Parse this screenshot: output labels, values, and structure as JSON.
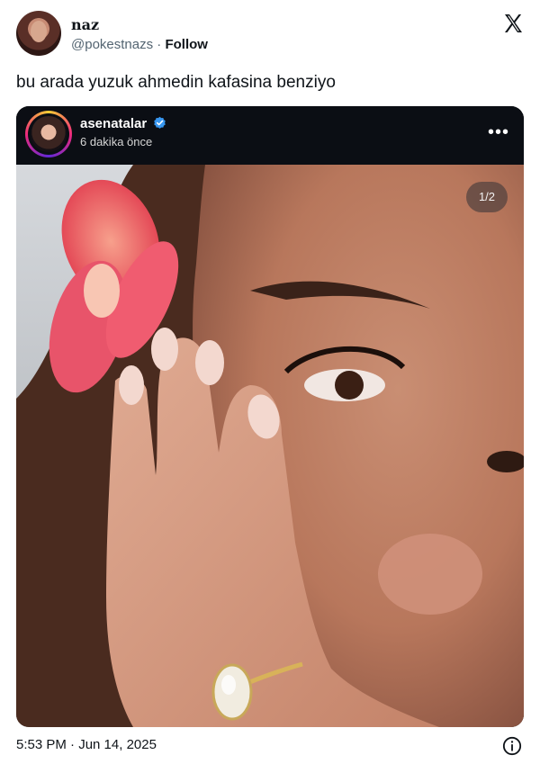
{
  "author": {
    "display_name": "naz",
    "handle": "@pokestnazs",
    "separator": "·",
    "follow_label": "Follow",
    "avatar_icon": "profile-photo",
    "platform_icon": "x-logo-icon"
  },
  "tweet": {
    "text": "bu arada yuzuk ahmedin kafasina benziyo",
    "timestamp": "5:53 PM · Jun 14, 2025"
  },
  "embedded_post": {
    "username": "asenatalar",
    "time_ago": "6 dakika önce",
    "more_label": "•••",
    "image_counter": "1/2",
    "verified_color": "#3897f0"
  },
  "colors": {
    "text": "#0f1419",
    "secondary_text": "#536471",
    "dark_header": "#0b0e14"
  }
}
